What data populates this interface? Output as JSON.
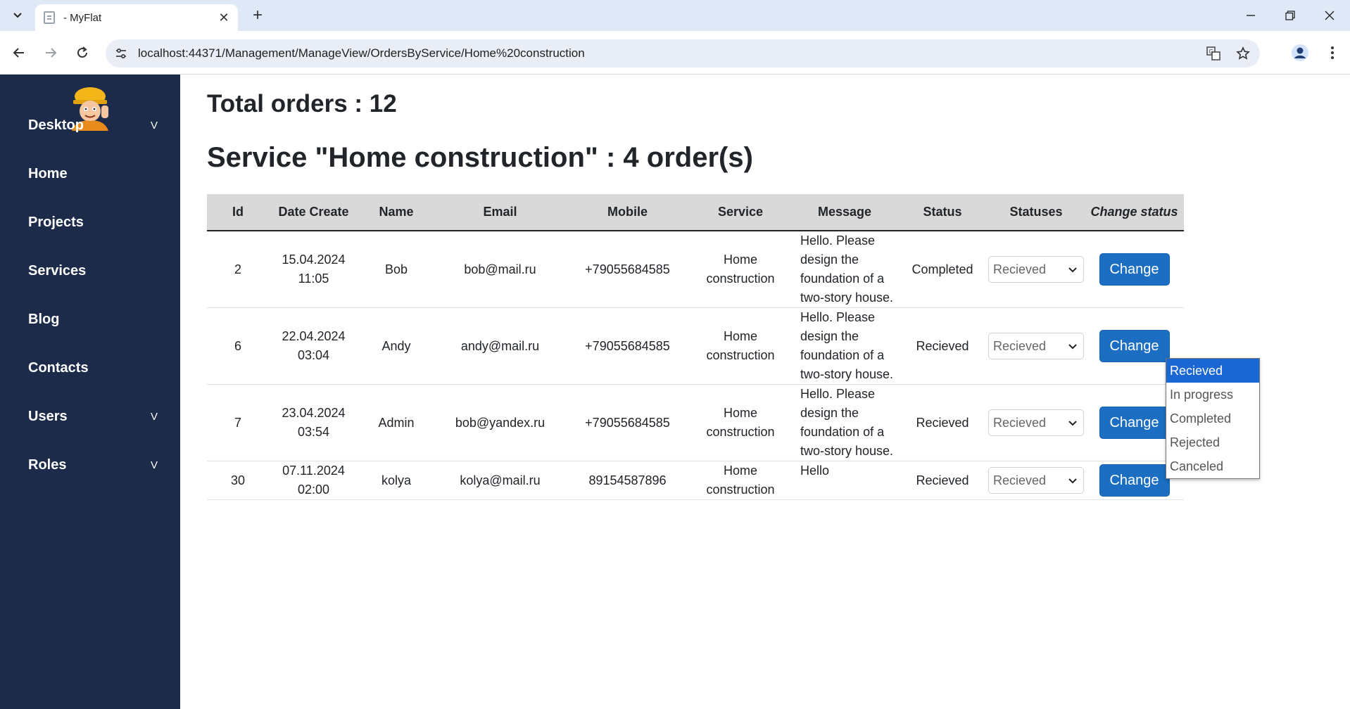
{
  "browser": {
    "tab_title": "- MyFlat",
    "url": "localhost:44371/Management/ManageView/OrdersByService/Home%20construction"
  },
  "sidebar": {
    "items": [
      {
        "label": "Desktop",
        "caret": "V"
      },
      {
        "label": "Home",
        "caret": ""
      },
      {
        "label": "Projects",
        "caret": ""
      },
      {
        "label": "Services",
        "caret": ""
      },
      {
        "label": "Blog",
        "caret": ""
      },
      {
        "label": "Contacts",
        "caret": ""
      },
      {
        "label": "Users",
        "caret": "V"
      },
      {
        "label": "Roles",
        "caret": "V"
      }
    ]
  },
  "main": {
    "total_orders": "Total orders : 12",
    "service_heading": "Service \"Home construction\" : 4 order(s)"
  },
  "table": {
    "headers": [
      "Id",
      "Date Create",
      "Name",
      "Email",
      "Mobile",
      "Service",
      "Message",
      "Status",
      "Statuses",
      "Change status"
    ],
    "rows": [
      {
        "id": "2",
        "date": "15.04.2024",
        "time": "11:05",
        "name": "Bob",
        "email": "bob@mail.ru",
        "mobile": "+79055684585",
        "service_1": "Home",
        "service_2": "construction",
        "message_1": "Hello. Please",
        "message_2": "design the",
        "message_3": "foundation of a",
        "message_4": "two-story house.",
        "status": "Completed",
        "select_value": "Recieved",
        "button": "Change"
      },
      {
        "id": "6",
        "date": "22.04.2024",
        "time": "03:04",
        "name": "Andy",
        "email": "andy@mail.ru",
        "mobile": "+79055684585",
        "service_1": "Home",
        "service_2": "construction",
        "message_1": "Hello. Please",
        "message_2": "design the",
        "message_3": "foundation of a",
        "message_4": "two-story house.",
        "status": "Recieved",
        "select_value": "Recieved",
        "button": "Change"
      },
      {
        "id": "7",
        "date": "23.04.2024",
        "time": "03:54",
        "name": "Admin",
        "email": "bob@yandex.ru",
        "mobile": "+79055684585",
        "service_1": "Home",
        "service_2": "construction",
        "message_1": "Hello. Please",
        "message_2": "design the",
        "message_3": "foundation of a",
        "message_4": "two-story house.",
        "status": "Recieved",
        "select_value": "Recieved",
        "button": "Change"
      },
      {
        "id": "30",
        "date": "07.11.2024",
        "time": "02:00",
        "name": "kolya",
        "email": "kolya@mail.ru",
        "mobile": "89154587896",
        "service_1": "Home",
        "service_2": "construction",
        "message_1": "Hello",
        "status": "Recieved",
        "select_value": "Recieved",
        "button": "Change"
      }
    ]
  },
  "dropdown": {
    "options": [
      "Recieved",
      "In progress",
      "Completed",
      "Rejected",
      "Canceled"
    ],
    "selected": "Recieved"
  },
  "colors": {
    "sidebar_bg": "#1d2b4a",
    "button_primary": "#1b6ec2",
    "dropdown_selected": "#1a66d2",
    "table_header_bg": "#d9d9d9"
  }
}
